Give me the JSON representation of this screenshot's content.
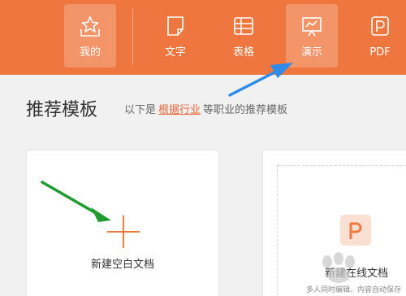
{
  "nav": {
    "items": [
      {
        "label": "我的",
        "icon": "star-inbox-icon",
        "active": true
      },
      {
        "label": "文字",
        "icon": "document-icon",
        "active": false
      },
      {
        "label": "表格",
        "icon": "spreadsheet-icon",
        "active": false
      },
      {
        "label": "演示",
        "icon": "presentation-icon",
        "active": true
      },
      {
        "label": "PDF",
        "icon": "pdf-icon",
        "active": false
      }
    ]
  },
  "section": {
    "title": "推荐模板",
    "subtitle_prefix": "以下是",
    "subtitle_link": "根据行业",
    "subtitle_suffix": "等职业的推荐模板"
  },
  "cards": {
    "blank_label": "新建空白文档",
    "online_label": "新建在线文档",
    "online_sub": "多人同时编辑、内容自动保存"
  },
  "colors": {
    "brand": "#f0763f",
    "accent": "#f07a3e",
    "annotation_blue": "#2f8be8",
    "annotation_green": "#1f9b2f"
  }
}
